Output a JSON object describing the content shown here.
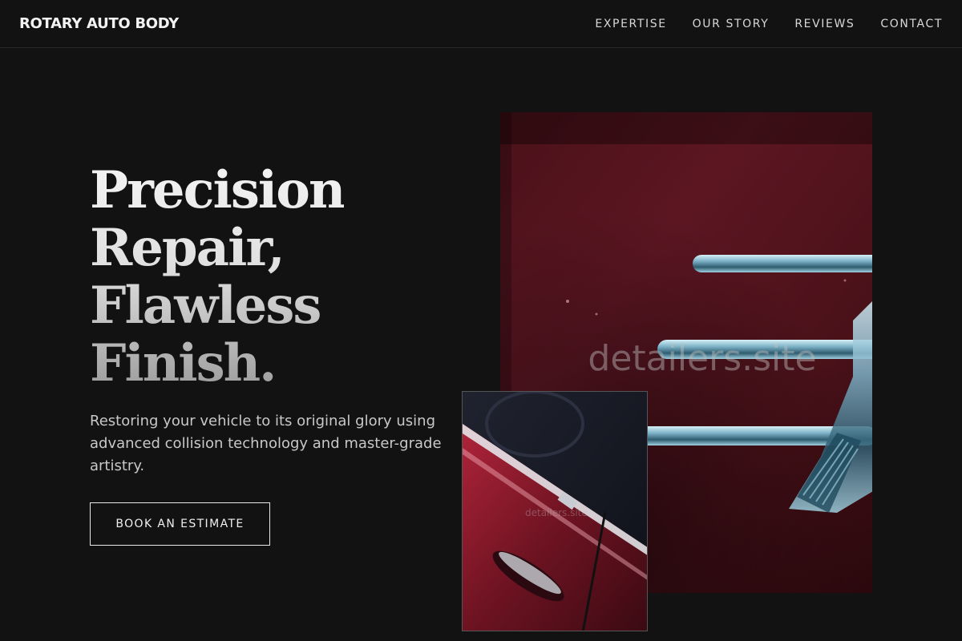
{
  "header": {
    "brand": "ROTARY AUTO BODY",
    "nav": [
      "EXPERTISE",
      "OUR STORY",
      "REVIEWS",
      "CONTACT"
    ]
  },
  "hero": {
    "title_lines": [
      "Precision",
      "Repair,",
      "Flawless",
      "Finish."
    ],
    "subtitle": "Restoring your vehicle to its original glory using advanced collision technology and master-grade artistry.",
    "cta_label": "BOOK AN ESTIMATE"
  },
  "images": {
    "main_watermark": "detailers.site",
    "inset_watermark": "detailers.site"
  },
  "colors": {
    "background": "#121212",
    "text": "#f2f2f2",
    "car_paint": "#5a1520",
    "chrome": "#7fb3c8"
  }
}
